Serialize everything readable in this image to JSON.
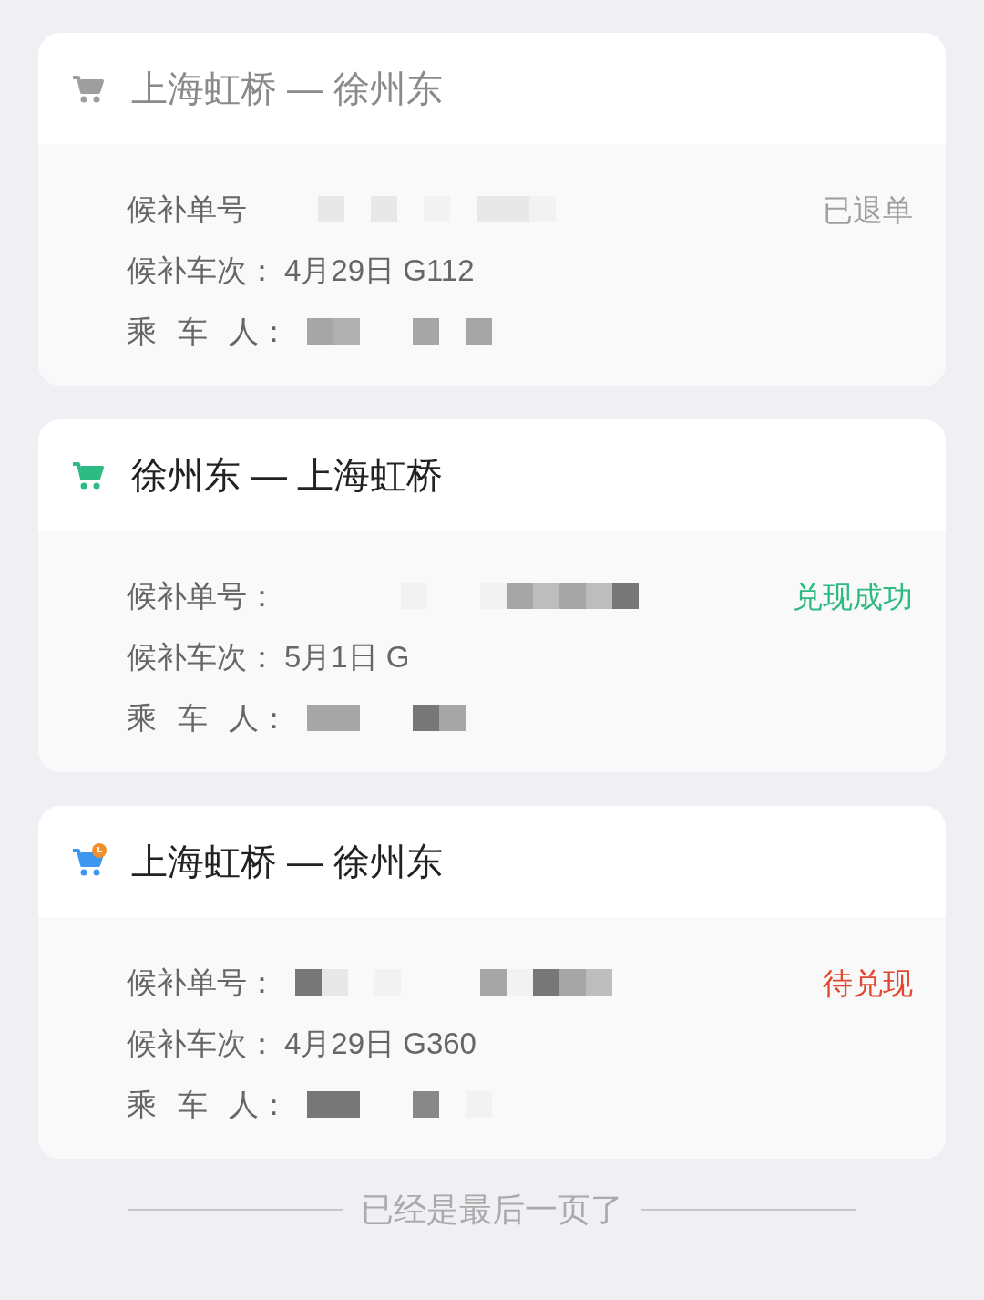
{
  "orders": [
    {
      "icon": {
        "color": "#9e9e9e",
        "pending_badge": false
      },
      "title": "上海虹桥 — 徐州东",
      "inactive": true,
      "status": {
        "text": "已退单",
        "color": "#9e9e9e"
      },
      "fields": [
        {
          "label": "候补单号"
        },
        {
          "label": "候补车次：",
          "value": "4月29日 G112"
        },
        {
          "label": "乘 车 人："
        }
      ]
    },
    {
      "icon": {
        "color": "#2dbb84",
        "pending_badge": false
      },
      "title": "徐州东 — 上海虹桥",
      "inactive": false,
      "status": {
        "text": "兑现成功",
        "color": "#2dbb84"
      },
      "fields": [
        {
          "label": "候补单号："
        },
        {
          "label": "候补车次：",
          "value": "5月1日 G"
        },
        {
          "label": "乘 车 人："
        }
      ]
    },
    {
      "icon": {
        "color": "#3d96f0",
        "pending_badge": true
      },
      "title": "上海虹桥 — 徐州东",
      "inactive": false,
      "status": {
        "text": "待兑现",
        "color": "#e0472e"
      },
      "fields": [
        {
          "label": "候补单号："
        },
        {
          "label": "候补车次：",
          "value": "4月29日 G360"
        },
        {
          "label": "乘 车 人："
        }
      ]
    }
  ],
  "footer": "已经是最后一页了"
}
